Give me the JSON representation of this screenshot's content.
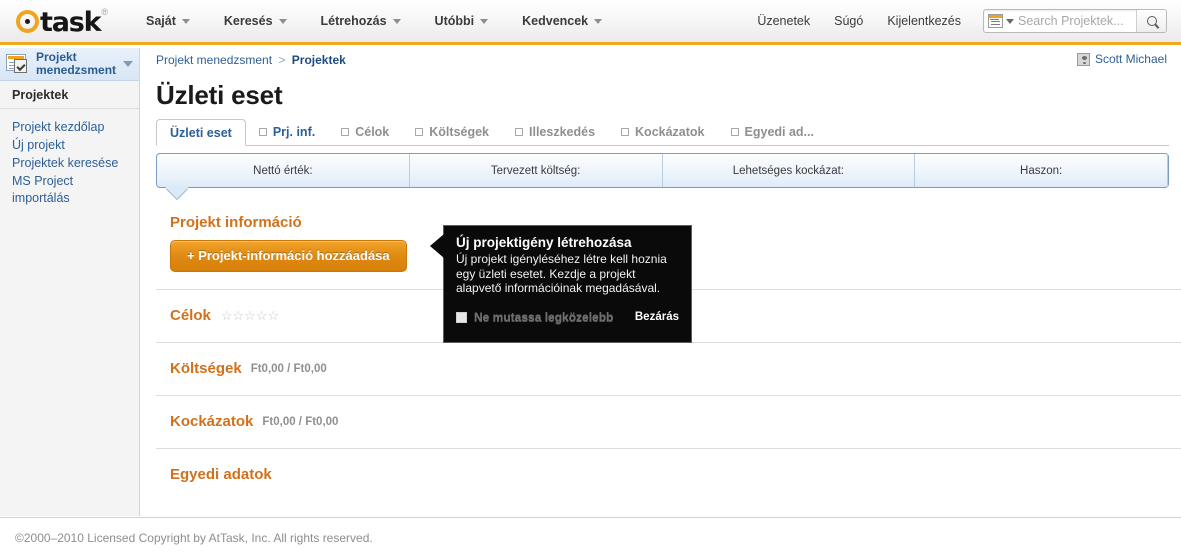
{
  "header": {
    "logo": {
      "text": "task",
      "icon": "at-circle-logo",
      "registered": "®"
    },
    "nav": [
      {
        "label": "Saját",
        "icon": "chevron-down-icon"
      },
      {
        "label": "Keresés",
        "icon": "chevron-down-icon"
      },
      {
        "label": "Létrehozás",
        "icon": "chevron-down-icon"
      },
      {
        "label": "Utóbbi",
        "icon": "chevron-down-icon"
      },
      {
        "label": "Kedvencek",
        "icon": "chevron-down-icon"
      }
    ],
    "right_links": [
      {
        "label": "Üzenetek"
      },
      {
        "label": "Súgó"
      },
      {
        "label": "Kijelentkezés"
      }
    ],
    "search": {
      "placeholder": "Search Projektek...",
      "value": "",
      "scope_icon": "search-scope-icon",
      "caret_icon": "chevron-down-icon",
      "submit_icon": "magnifier-icon"
    },
    "accent_color": "#f0a41c"
  },
  "sidebar": {
    "header": {
      "label": "Projekt menedzsment",
      "icon": "project-management-icon",
      "caret": "chevron-down-icon"
    },
    "section_label": "Projektek",
    "items": [
      {
        "label": "Projekt kezdőlap"
      },
      {
        "label": "Új projekt"
      },
      {
        "label": "Projektek keresése"
      },
      {
        "label": "MS Project importálás"
      }
    ]
  },
  "content": {
    "breadcrumb": {
      "root": "Projekt menedzsment",
      "separator": ">",
      "current": "Projektek"
    },
    "user": {
      "name": "Scott Michael",
      "icon": "avatar-icon"
    },
    "page_title": "Üzleti eset",
    "tabs": [
      {
        "label": "Üzleti eset",
        "active": true,
        "checkbox": false,
        "state": "active"
      },
      {
        "label": "Prj. inf.",
        "active": false,
        "checkbox": true,
        "state": "link"
      },
      {
        "label": "Célok",
        "active": false,
        "checkbox": true,
        "state": "dim"
      },
      {
        "label": "Költségek",
        "active": false,
        "checkbox": true,
        "state": "dim"
      },
      {
        "label": "Illeszkedés",
        "active": false,
        "checkbox": true,
        "state": "dim"
      },
      {
        "label": "Kockázatok",
        "active": false,
        "checkbox": true,
        "state": "dim"
      },
      {
        "label": "Egyedi ad...",
        "active": false,
        "checkbox": true,
        "state": "dim"
      }
    ],
    "summary": [
      {
        "label": "Nettó érték:"
      },
      {
        "label": "Tervezett költség:"
      },
      {
        "label": "Lehetséges kockázat:"
      },
      {
        "label": "Haszon:"
      }
    ],
    "sections": [
      {
        "title": "Projekt információ",
        "meta": "",
        "stars": 0,
        "button": "+ Projekt-információ hozzáadása"
      },
      {
        "title": "Célok",
        "meta": "",
        "stars": 5,
        "button": ""
      },
      {
        "title": "Költségek",
        "meta": "Ft0,00 / Ft0,00",
        "stars": 0,
        "button": ""
      },
      {
        "title": "Kockázatok",
        "meta": "Ft0,00 / Ft0,00",
        "stars": 0,
        "button": ""
      },
      {
        "title": "Egyedi adatok",
        "meta": "",
        "stars": 0,
        "button": ""
      }
    ]
  },
  "tooltip": {
    "title": "Új projektigény létrehozása",
    "body": "Új projekt igényléséhez létre kell hoznia egy üzleti esetet. Kezdje a projekt alapvető információinak megadásával.",
    "checkbox_label": "Ne mutassa legközelebb",
    "checkbox_checked": false,
    "close_label": "Bezárás"
  },
  "footer": {
    "text": "©2000–2010 Licensed Copyright by AtTask, Inc. All rights reserved."
  },
  "colors": {
    "brand_orange": "#f0a41c",
    "section_orange": "#d2711b",
    "link_blue": "#2d5f96"
  }
}
